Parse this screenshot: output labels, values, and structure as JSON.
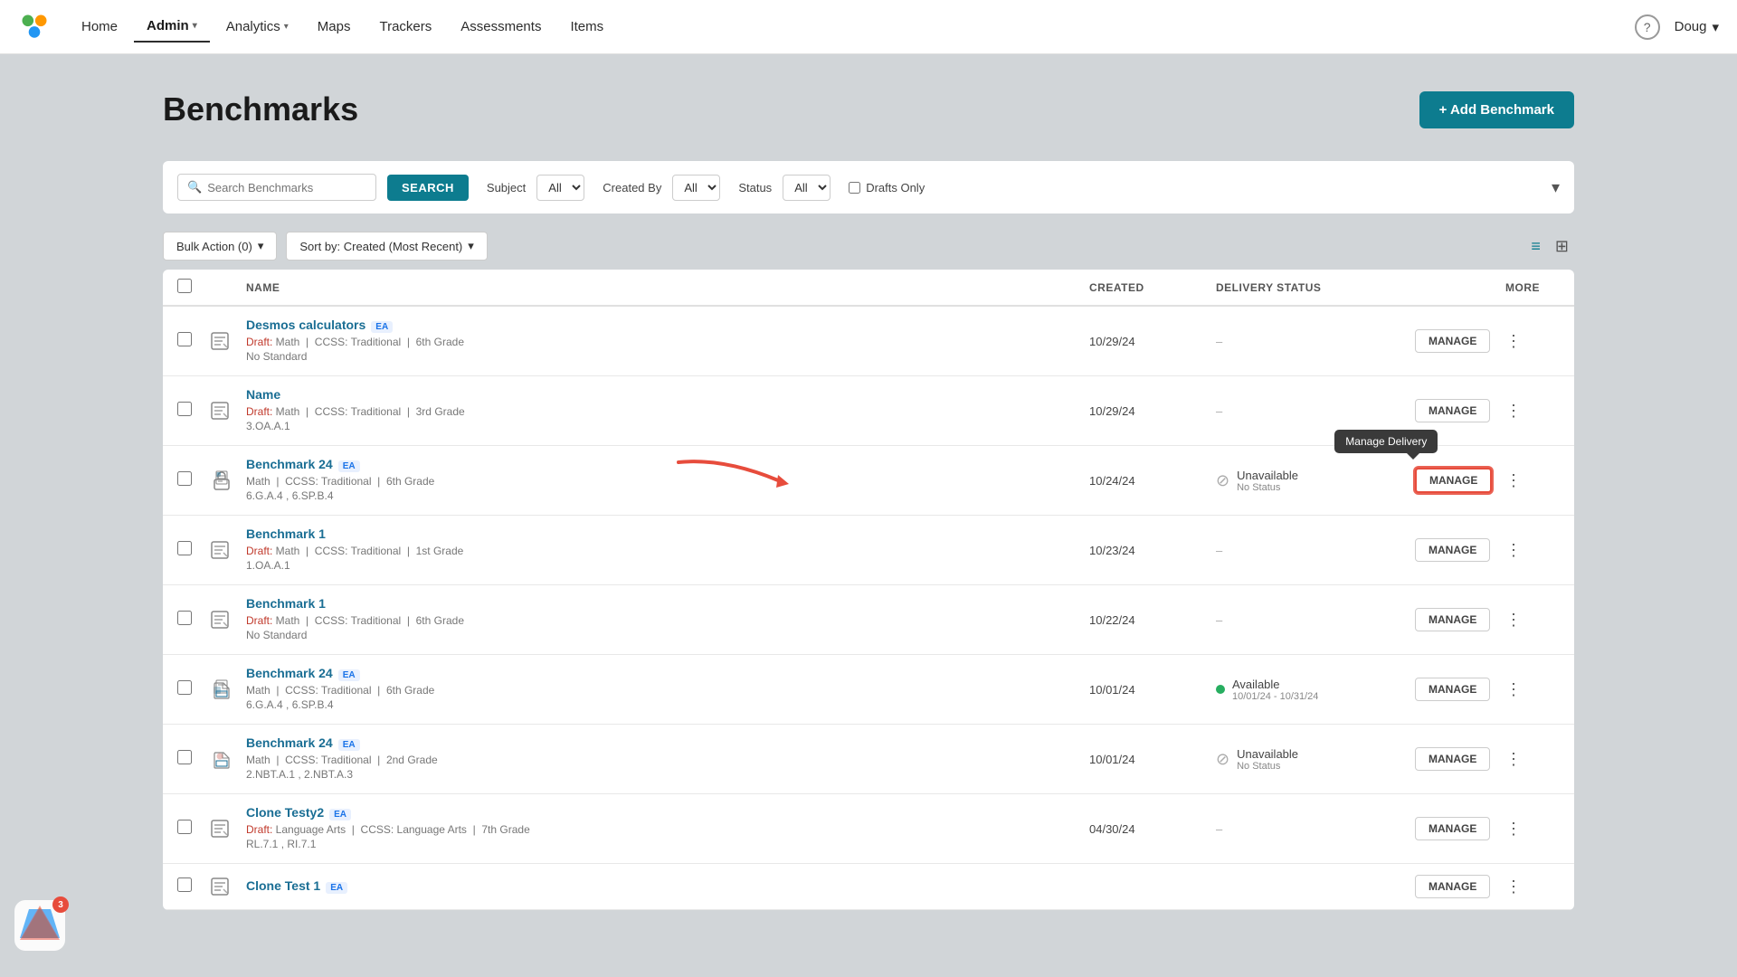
{
  "app": {
    "logo_text": "●●●",
    "badge_count": "3"
  },
  "nav": {
    "items": [
      {
        "id": "home",
        "label": "Home",
        "active": false,
        "has_dropdown": false
      },
      {
        "id": "admin",
        "label": "Admin",
        "active": true,
        "has_dropdown": true
      },
      {
        "id": "analytics",
        "label": "Analytics",
        "active": false,
        "has_dropdown": true
      },
      {
        "id": "maps",
        "label": "Maps",
        "active": false,
        "has_dropdown": false
      },
      {
        "id": "trackers",
        "label": "Trackers",
        "active": false,
        "has_dropdown": false
      },
      {
        "id": "assessments",
        "label": "Assessments",
        "active": false,
        "has_dropdown": false
      },
      {
        "id": "items",
        "label": "Items",
        "active": false,
        "has_dropdown": false
      }
    ],
    "user_name": "Doug",
    "help_label": "?"
  },
  "page": {
    "title": "Benchmarks",
    "add_button_label": "+ Add Benchmark"
  },
  "filters": {
    "search_placeholder": "Search Benchmarks",
    "search_button_label": "SEARCH",
    "subject_label": "Subject",
    "subject_value": "All",
    "created_by_label": "Created By",
    "created_by_value": "All",
    "status_label": "Status",
    "status_value": "All",
    "drafts_only_label": "Drafts Only"
  },
  "toolbar": {
    "bulk_action_label": "Bulk Action (0)",
    "sort_label": "Sort by: Created (Most Recent)"
  },
  "table": {
    "columns": [
      "ALL",
      "NAME",
      "CREATED",
      "DELIVERY STATUS",
      "MORE"
    ],
    "rows": [
      {
        "id": "row1",
        "name": "Desmos calculators",
        "has_ea": true,
        "has_lock": false,
        "status_type": "draft",
        "meta": "Draft: Math  |  CCSS: Traditional  |  6th Grade",
        "standard": "No Standard",
        "created": "10/29/24",
        "delivery_status": "none",
        "delivery_label": "",
        "delivery_sub": "",
        "icon_type": "edit"
      },
      {
        "id": "row2",
        "name": "Name",
        "has_ea": false,
        "has_lock": false,
        "status_type": "draft",
        "meta": "Draft: Math  |  CCSS: Traditional  |  3rd Grade",
        "standard": "3.OA.A.1",
        "created": "10/29/24",
        "delivery_status": "none",
        "delivery_label": "",
        "delivery_sub": "",
        "icon_type": "edit"
      },
      {
        "id": "row3",
        "name": "Benchmark 24",
        "has_ea": true,
        "has_lock": true,
        "status_type": "normal",
        "meta": "Math  |  CCSS: Traditional  |  6th Grade",
        "standard": "6.G.A.4 , 6.SP.B.4",
        "created": "10/24/24",
        "delivery_status": "unavailable",
        "delivery_label": "Unavailable",
        "delivery_sub": "No Status",
        "icon_type": "lock",
        "tooltip_active": true,
        "tooltip_label": "Manage Delivery"
      },
      {
        "id": "row4",
        "name": "Benchmark 1",
        "has_ea": false,
        "has_lock": false,
        "status_type": "draft",
        "meta": "Draft: Math  |  CCSS: Traditional  |  1st Grade",
        "standard": "1.OA.A.1",
        "created": "10/23/24",
        "delivery_status": "none",
        "delivery_label": "",
        "delivery_sub": "",
        "icon_type": "edit"
      },
      {
        "id": "row5",
        "name": "Benchmark 1",
        "has_ea": false,
        "has_lock": false,
        "status_type": "draft",
        "meta": "Draft: Math  |  CCSS: Traditional  |  6th Grade",
        "standard": "No Standard",
        "created": "10/22/24",
        "delivery_status": "none",
        "delivery_label": "",
        "delivery_sub": "",
        "icon_type": "edit"
      },
      {
        "id": "row6",
        "name": "Benchmark 24",
        "has_ea": true,
        "has_lock": true,
        "status_type": "normal",
        "meta": "Math  |  CCSS: Traditional  |  6th Grade",
        "standard": "6.G.A.4 , 6.SP.B.4",
        "created": "10/01/24",
        "delivery_status": "available",
        "delivery_label": "Available",
        "delivery_sub": "10/01/24 - 10/31/24",
        "icon_type": "lock"
      },
      {
        "id": "row7",
        "name": "Benchmark 24",
        "has_ea": true,
        "has_lock": true,
        "status_type": "normal",
        "meta": "Math  |  CCSS: Traditional  |  2nd Grade",
        "standard": "2.NBT.A.1 , 2.NBT.A.3",
        "created": "10/01/24",
        "delivery_status": "unavailable",
        "delivery_label": "Unavailable",
        "delivery_sub": "No Status",
        "icon_type": "lock"
      },
      {
        "id": "row8",
        "name": "Clone Testy2",
        "has_ea": true,
        "has_lock": false,
        "status_type": "draft",
        "meta": "Draft: Language Arts  |  CCSS: Language Arts  |  7th Grade",
        "standard": "RL.7.1 , RI.7.1",
        "created": "04/30/24",
        "delivery_status": "none",
        "delivery_label": "",
        "delivery_sub": "",
        "icon_type": "edit"
      },
      {
        "id": "row9",
        "name": "Clone Test 1",
        "has_ea": true,
        "has_lock": false,
        "status_type": "draft",
        "meta": "",
        "standard": "",
        "created": "",
        "delivery_status": "none",
        "delivery_label": "",
        "delivery_sub": "",
        "icon_type": "edit"
      }
    ],
    "manage_label": "MANAGE"
  }
}
